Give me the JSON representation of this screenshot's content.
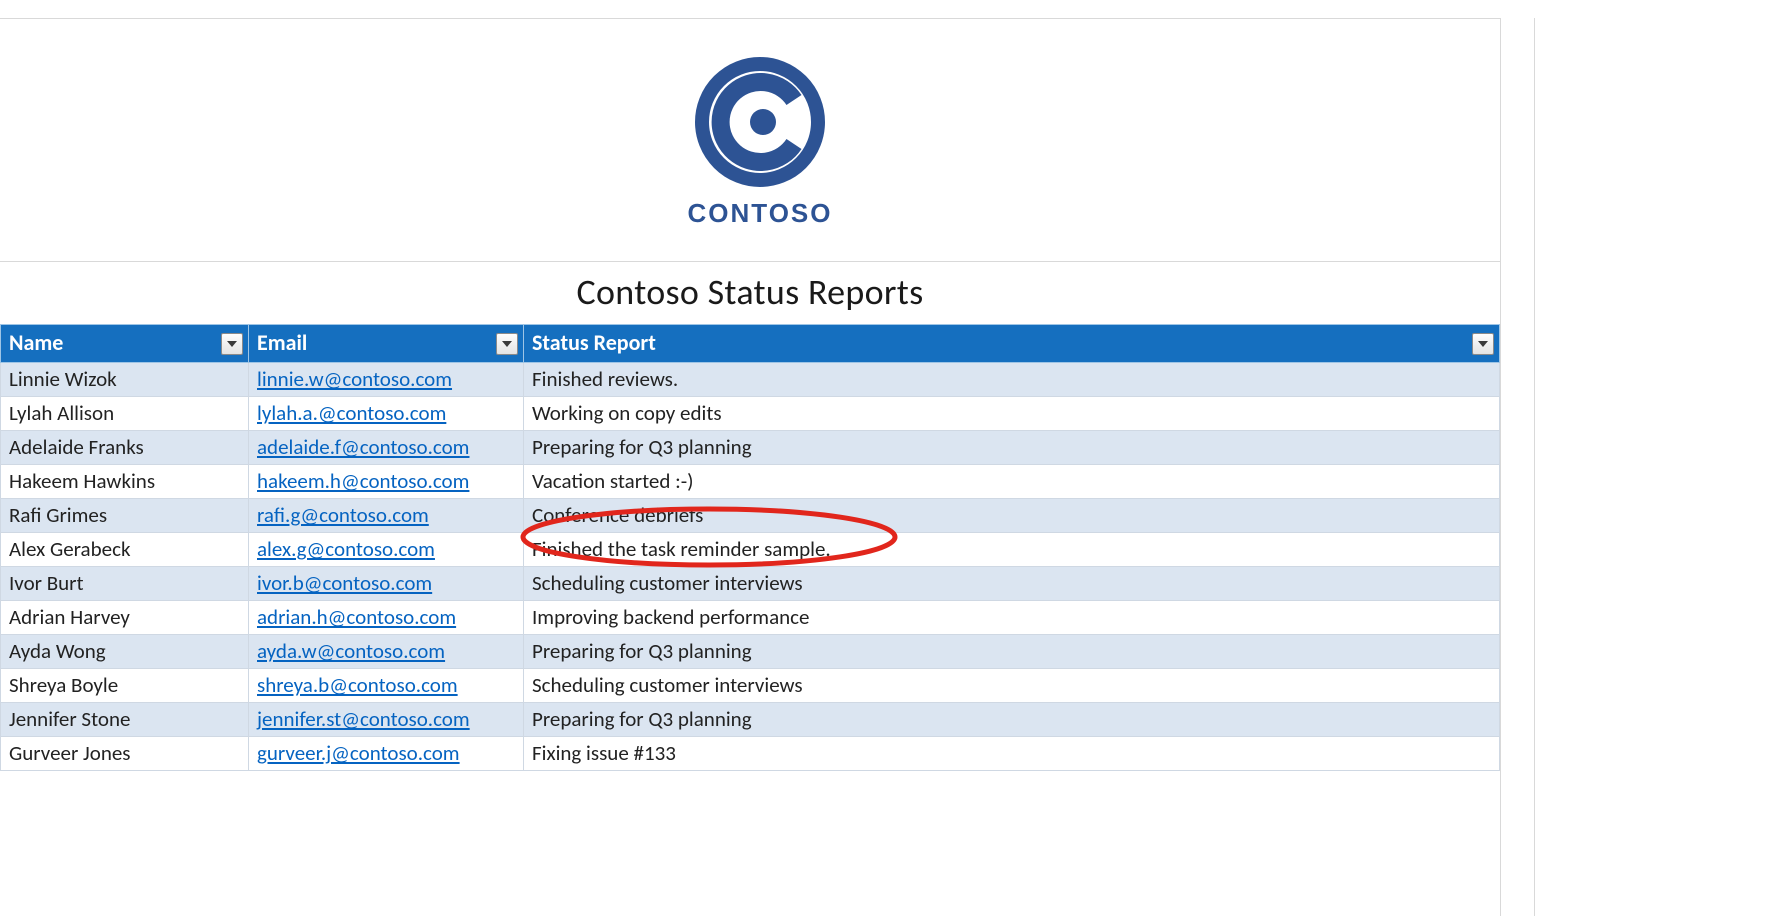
{
  "brand": {
    "wordmark": "CONTOSO",
    "accent_color": "#2d5394"
  },
  "title": "Contoso Status Reports",
  "columns": {
    "name": "Name",
    "email": "Email",
    "status": "Status Report"
  },
  "rows": [
    {
      "name": "Linnie Wizok",
      "email": "linnie.w@contoso.com",
      "status": "Finished reviews."
    },
    {
      "name": "Lylah Allison",
      "email": "lylah.a.@contoso.com",
      "status": "Working on copy edits"
    },
    {
      "name": "Adelaide Franks",
      "email": "adelaide.f@contoso.com",
      "status": "Preparing for Q3 planning"
    },
    {
      "name": "Hakeem Hawkins",
      "email": "hakeem.h@contoso.com",
      "status": "Vacation started :-)"
    },
    {
      "name": "Rafi Grimes",
      "email": "rafi.g@contoso.com",
      "status": "Conference debriefs"
    },
    {
      "name": "Alex Gerabeck",
      "email": "alex.g@contoso.com",
      "status": "Finished the task reminder sample."
    },
    {
      "name": "Ivor Burt",
      "email": "ivor.b@contoso.com",
      "status": "Scheduling customer interviews"
    },
    {
      "name": "Adrian Harvey",
      "email": "adrian.h@contoso.com",
      "status": "Improving backend performance"
    },
    {
      "name": "Ayda Wong",
      "email": "ayda.w@contoso.com",
      "status": "Preparing for Q3 planning"
    },
    {
      "name": "Shreya Boyle",
      "email": "shreya.b@contoso.com",
      "status": "Scheduling customer interviews"
    },
    {
      "name": "Jennifer Stone",
      "email": "jennifer.st@contoso.com",
      "status": "Preparing for Q3 planning"
    },
    {
      "name": "Gurveer Jones",
      "email": "gurveer.j@contoso.com",
      "status": "Fixing issue #133"
    }
  ],
  "annotation": {
    "highlight_row_index": 5,
    "highlight_color": "#e1261c"
  }
}
